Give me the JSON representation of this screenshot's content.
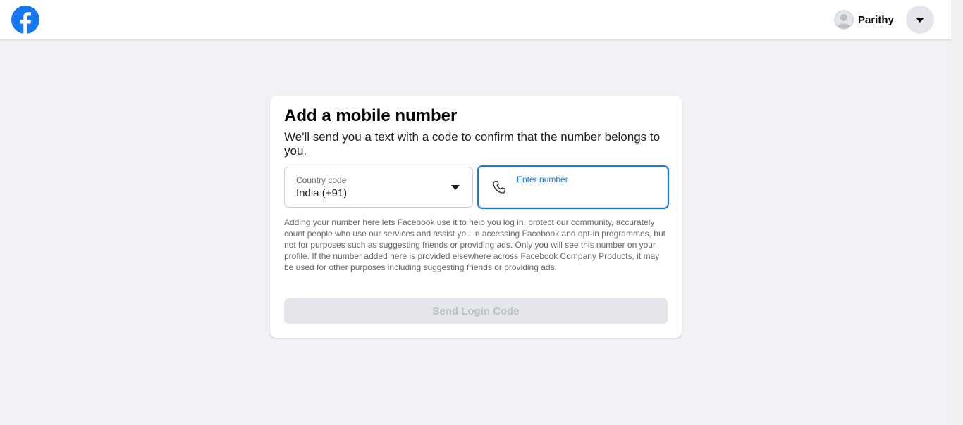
{
  "header": {
    "logo_icon": "facebook-logo-icon",
    "profile_name": "Parithy",
    "account_menu_icon": "caret-down-icon"
  },
  "card": {
    "title": "Add a mobile number",
    "subtitle": "We'll send you a text with a code to confirm that the number belongs to you.",
    "country_code": {
      "label": "Country code",
      "value": "India (+91)"
    },
    "number_field": {
      "label": "Enter number",
      "value": ""
    },
    "disclaimer": "Adding your number here lets Facebook use it to help you log in, protect our community, accurately count people who use our services and assist you in accessing Facebook and opt-in programmes, but not for purposes such as suggesting friends or providing ads. Only you will see this number on your profile. If the number added here is provided elsewhere across Facebook Company Products, it may be used for other purposes including suggesting friends or providing ads.",
    "send_button_label": "Send Login Code"
  },
  "colors": {
    "brand_blue": "#1877f2",
    "page_background": "#f0f2f5",
    "disabled_button_bg": "#e4e6eb",
    "disabled_button_text": "#bcc0c4"
  }
}
